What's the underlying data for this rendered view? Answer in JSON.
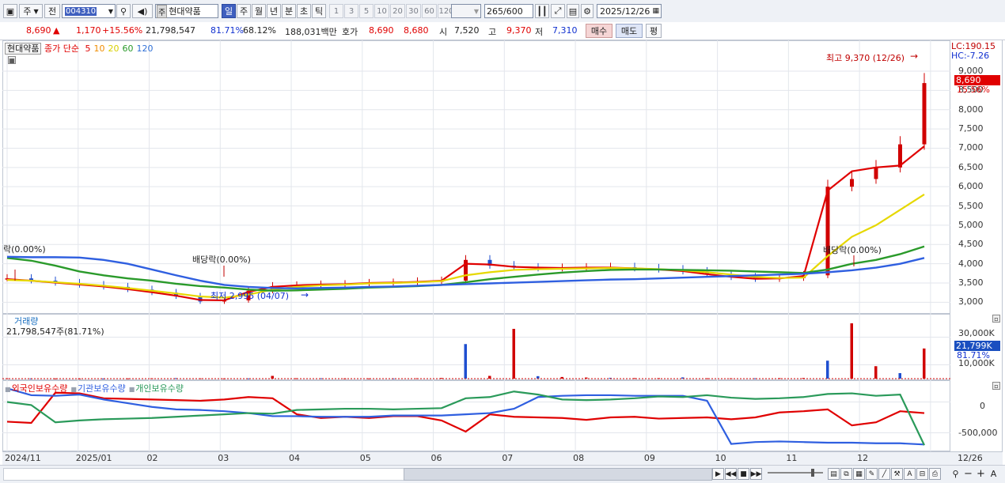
{
  "toolbar": {
    "market": "주",
    "prev": "전",
    "code": "004310",
    "stock_name": "현대약품",
    "name_badge": "주",
    "periods": [
      "일",
      "주",
      "월",
      "년",
      "분",
      "초",
      "틱"
    ],
    "minute_steps": [
      "1",
      "3",
      "5",
      "10",
      "20",
      "30",
      "60",
      "120"
    ],
    "count": "265",
    "count_max": "/600",
    "date": "2025/12/26"
  },
  "quote": {
    "price": "8,690",
    "arrow": "▲",
    "change": "1,170",
    "change_pct": "+15.56%",
    "volume": "21,798,547",
    "vol_ratio": "81.71%",
    "turnover": "68.12%",
    "amount": "188,031백만",
    "bid_label": "호가",
    "bid": "8,690",
    "ask": "8,680",
    "open_label": "시",
    "open": "7,520",
    "high_label": "고",
    "high": "9,370",
    "low_label": "저",
    "low": "7,310",
    "buy_label": "매수",
    "sell_label": "매도",
    "eval_label": "평"
  },
  "price_panel": {
    "legend_name": "현대약품",
    "legend_series": "종가 단순",
    "ma_labels": [
      "5",
      "10",
      "20",
      "60",
      "120"
    ],
    "ma_colors": [
      "#e00000",
      "#f08c00",
      "#d8d000",
      "#2a9a2a",
      "#2f6fd6"
    ],
    "lc_label": "LC:190.15",
    "hc_label": "HC:-7.26",
    "current_tag": "8,690",
    "current_pct": "15.56%",
    "high_note": "최고 9,370 (12/26)",
    "low_note": "최저 2,995 (04/07)",
    "dividend_1": "배당락(0.00%)",
    "dividend_2": "배당락(0.00%)",
    "dividend_0": "락(0.00%)",
    "y_ticks": [
      "9,000",
      "8,500",
      "8,000",
      "7,500",
      "7,000",
      "6,500",
      "6,000",
      "5,500",
      "5,000",
      "4,500",
      "4,000",
      "3,500",
      "3,000"
    ]
  },
  "volume_panel": {
    "title": "거래량",
    "value": "21,798,547주(81.71%)",
    "tag": "21,799K",
    "pct": "81.71%",
    "y_ticks": [
      "30,000K",
      "10,000K"
    ]
  },
  "holding_panel": {
    "series": [
      {
        "name": "외국인보유수량",
        "color": "#e00000"
      },
      {
        "name": "기관보유수량",
        "color": "#2f5fe0"
      },
      {
        "name": "개인보유수량",
        "color": "#2a9a5a"
      }
    ],
    "y_ticks": [
      "0",
      "-500,000"
    ]
  },
  "x_axis": {
    "labels": [
      "2024/11",
      "2025/01",
      "02",
      "03",
      "04",
      "05",
      "06",
      "07",
      "08",
      "09",
      "10",
      "11",
      "12",
      "12/26"
    ]
  },
  "chart_data": [
    {
      "type": "line",
      "title": "",
      "xlabel": "",
      "ylabel": "",
      "ylim": [
        2700,
        9800
      ],
      "series": [
        {
          "name": "종가",
          "values": [
            3620,
            3560,
            3500,
            3450,
            3400,
            3330,
            3250,
            3150,
            3020,
            3050,
            3300,
            3420,
            3440,
            3460,
            3470,
            3500,
            3510,
            3540,
            3560,
            4100,
            3950,
            3900,
            3880,
            3890,
            3900,
            3910,
            3880,
            3850,
            3800,
            3720,
            3650,
            3600,
            3630,
            3700,
            6000,
            6200,
            6500,
            7100,
            8690
          ]
        },
        {
          "name": "5",
          "values": [
            3600,
            3560,
            3510,
            3460,
            3410,
            3340,
            3260,
            3170,
            3060,
            3050,
            3270,
            3400,
            3440,
            3460,
            3470,
            3500,
            3510,
            3530,
            3560,
            4000,
            3980,
            3920,
            3900,
            3890,
            3900,
            3900,
            3880,
            3850,
            3810,
            3730,
            3660,
            3610,
            3620,
            3680,
            5900,
            6400,
            6500,
            6550,
            7050
          ]
        },
        {
          "name": "20",
          "values": [
            3580,
            3560,
            3520,
            3480,
            3430,
            3370,
            3300,
            3230,
            3150,
            3120,
            3200,
            3330,
            3400,
            3440,
            3460,
            3490,
            3500,
            3520,
            3550,
            3700,
            3780,
            3840,
            3860,
            3870,
            3880,
            3890,
            3880,
            3860,
            3830,
            3780,
            3720,
            3660,
            3630,
            3640,
            4200,
            4700,
            5000,
            5400,
            5800
          ]
        },
        {
          "name": "60",
          "values": [
            4150,
            4080,
            3950,
            3800,
            3700,
            3620,
            3560,
            3480,
            3420,
            3380,
            3330,
            3300,
            3310,
            3330,
            3350,
            3380,
            3400,
            3420,
            3450,
            3520,
            3600,
            3660,
            3720,
            3770,
            3810,
            3840,
            3850,
            3850,
            3840,
            3830,
            3820,
            3800,
            3780,
            3760,
            3850,
            4000,
            4100,
            4250,
            4450
          ]
        },
        {
          "name": "120",
          "values": [
            4180,
            4170,
            4170,
            4160,
            4100,
            4000,
            3850,
            3700,
            3560,
            3450,
            3400,
            3370,
            3360,
            3370,
            3380,
            3400,
            3410,
            3430,
            3450,
            3470,
            3490,
            3510,
            3530,
            3550,
            3570,
            3590,
            3600,
            3620,
            3640,
            3660,
            3680,
            3700,
            3720,
            3740,
            3780,
            3830,
            3900,
            4000,
            4150
          ]
        }
      ]
    },
    {
      "type": "bar",
      "title": "",
      "ylim": [
        0,
        40000
      ],
      "series": [
        {
          "name": "거래량",
          "values": [
            300,
            200,
            200,
            150,
            150,
            200,
            300,
            400,
            250,
            200,
            200,
            2000,
            300,
            300,
            200,
            200,
            200,
            300,
            500,
            25000,
            2000,
            36000,
            1800,
            1200,
            800,
            600,
            400,
            400,
            900,
            300,
            300,
            300,
            400,
            500,
            13000,
            40000,
            9000,
            4000,
            21799
          ]
        }
      ]
    },
    {
      "type": "line",
      "title": "",
      "ylim": [
        -750000,
        250000
      ],
      "series": [
        {
          "name": "외국인보유수량",
          "values": [
            -320000,
            -340000,
            150000,
            140000,
            60000,
            50000,
            40000,
            30000,
            20000,
            40000,
            80000,
            60000,
            -200000,
            -260000,
            -240000,
            -260000,
            -230000,
            -230000,
            -300000,
            -480000,
            -200000,
            -240000,
            -250000,
            -260000,
            -290000,
            -250000,
            -240000,
            -270000,
            -260000,
            -250000,
            -280000,
            -250000,
            -170000,
            -150000,
            -120000,
            -380000,
            -330000,
            -150000,
            -180000
          ]
        },
        {
          "name": "기관보유수량",
          "values": [
            220000,
            110000,
            100000,
            120000,
            40000,
            -20000,
            -80000,
            -120000,
            -130000,
            -150000,
            -180000,
            -230000,
            -230000,
            -240000,
            -240000,
            -240000,
            -220000,
            -220000,
            -220000,
            -200000,
            -180000,
            -110000,
            80000,
            100000,
            110000,
            110000,
            100000,
            100000,
            100000,
            20000,
            -680000,
            -650000,
            -640000,
            -650000,
            -660000,
            -660000,
            -670000,
            -670000,
            -690000
          ]
        },
        {
          "name": "개인보유수량",
          "values": [
            0,
            -50000,
            -330000,
            -300000,
            -280000,
            -270000,
            -260000,
            -240000,
            -220000,
            -200000,
            -180000,
            -190000,
            -130000,
            -120000,
            -110000,
            -110000,
            -120000,
            -110000,
            -100000,
            60000,
            80000,
            170000,
            120000,
            40000,
            30000,
            40000,
            60000,
            90000,
            80000,
            110000,
            70000,
            50000,
            60000,
            80000,
            130000,
            140000,
            100000,
            120000,
            -700000
          ]
        }
      ]
    }
  ]
}
